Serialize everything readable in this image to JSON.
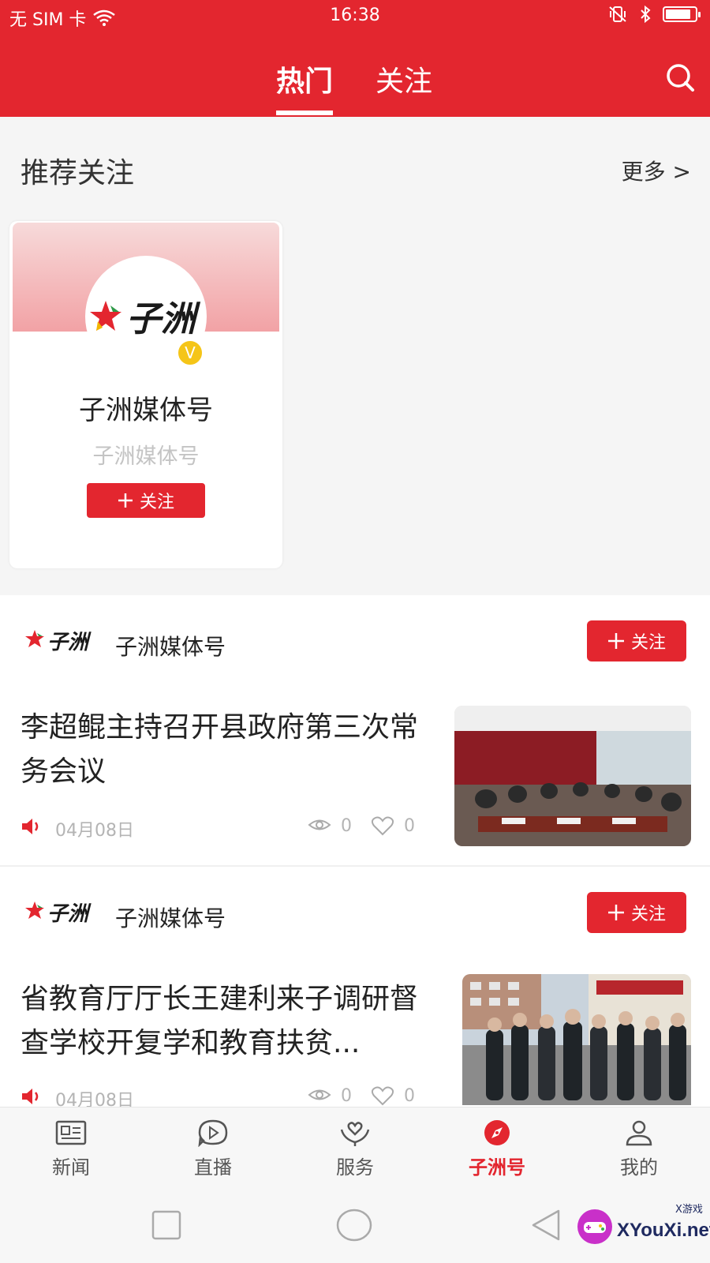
{
  "status_bar": {
    "carrier": "无 SIM 卡",
    "time": "16:38",
    "battery_level": 0.85
  },
  "header": {
    "tabs": [
      {
        "label": "热门",
        "active": true
      },
      {
        "label": "关注",
        "active": false
      }
    ],
    "search_icon": "search-icon",
    "color": "#e3262f"
  },
  "recommend": {
    "title": "推荐关注",
    "more": "更多 >",
    "card": {
      "logo_text": "子洲",
      "badge": "V",
      "name": "子洲媒体号",
      "subtitle": "子洲媒体号",
      "follow_label": "关注"
    }
  },
  "feed": [
    {
      "source_logo": "子洲",
      "source_name": "子洲媒体号",
      "follow_label": "关注",
      "title": "李超鲲主持召开县政府第三次常务会议",
      "date": "04月08日",
      "views": "0",
      "likes": "0"
    },
    {
      "source_logo": "子洲",
      "source_name": "子洲媒体号",
      "follow_label": "关注",
      "title": "省教育厅厅长王建利来子调研督查学校开复学和教育扶贫...",
      "date": "04月08日",
      "views": "0",
      "likes": "0"
    }
  ],
  "bottom_nav": [
    {
      "label": "新闻",
      "icon": "news-icon",
      "active": false
    },
    {
      "label": "直播",
      "icon": "play-icon",
      "active": false
    },
    {
      "label": "服务",
      "icon": "service-icon",
      "active": false
    },
    {
      "label": "子洲号",
      "icon": "compass-icon",
      "active": true
    },
    {
      "label": "我的",
      "icon": "user-icon",
      "active": false
    }
  ],
  "watermark": {
    "text": "XYouXi.net",
    "sub": "X游戏"
  }
}
